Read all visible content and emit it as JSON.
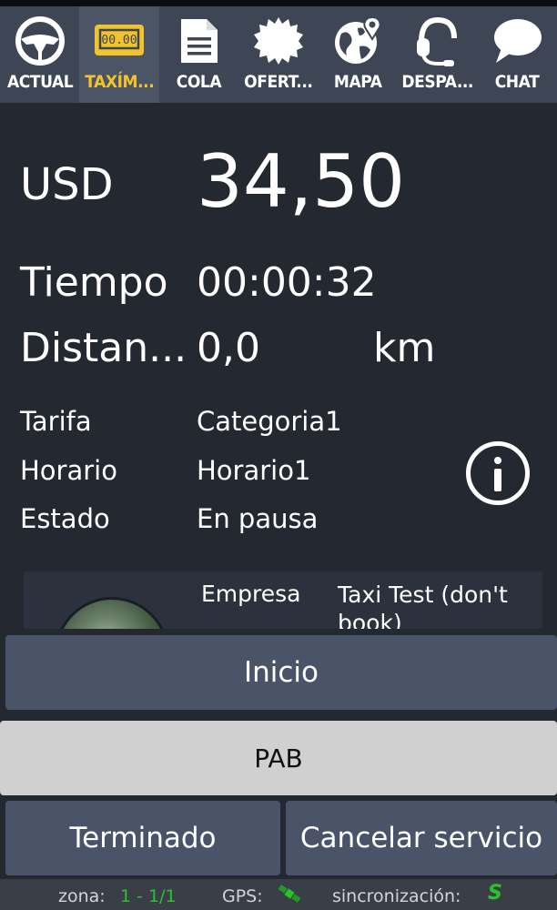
{
  "tabs": [
    {
      "label": "ACTUAL",
      "icon": "steering-wheel-icon",
      "active": false
    },
    {
      "label": "TAXÍM...",
      "icon": "taximeter-icon",
      "active": true
    },
    {
      "label": "COLA",
      "icon": "document-icon",
      "active": false
    },
    {
      "label": "OFERT...",
      "icon": "badge-icon",
      "active": false
    },
    {
      "label": "MAPA",
      "icon": "globe-pin-icon",
      "active": false
    },
    {
      "label": "DESPA...",
      "icon": "headset-icon",
      "active": false
    },
    {
      "label": "CHAT",
      "icon": "chat-bubble-icon",
      "active": false
    }
  ],
  "meter": {
    "taximeter_display": "00.00",
    "currency": "USD",
    "amount": "34,50",
    "time_label": "Tiempo",
    "time_value": "00:00:32",
    "distance_label": "Distan...",
    "distance_value": "0,0",
    "distance_unit": "km"
  },
  "details": {
    "fare_label": "Tarifa",
    "fare_value": "Categoria1",
    "schedule_label": "Horario",
    "schedule_value": "Horario1",
    "state_label": "Estado",
    "state_value": "En pausa"
  },
  "company": {
    "label": "Empresa",
    "value": "Taxi Test (don't book)"
  },
  "buttons": {
    "start": "Inicio",
    "pab": "PAB",
    "finished": "Terminado",
    "cancel": "Cancelar servicio"
  },
  "status_bar": {
    "zone_label": "zona:",
    "zone_value": "1 - 1/1",
    "gps_label": "GPS:",
    "sync_label": "sincronización:",
    "sync_value": "S"
  },
  "colors": {
    "background": "#232831",
    "tabbar": "#3e4655",
    "active_tab_label": "#f2c32b",
    "button": "#4a5468",
    "status_ok": "#27c52a"
  }
}
